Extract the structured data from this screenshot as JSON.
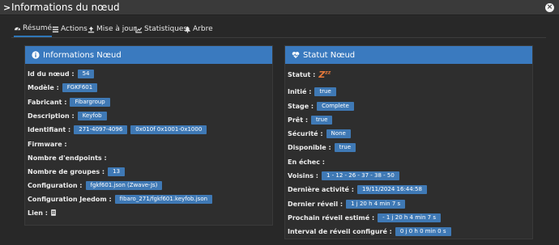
{
  "window": {
    "title": "Informations du nœud"
  },
  "tabs": [
    {
      "label": "Résumé",
      "icon": "dashboard-icon"
    },
    {
      "label": "Actions",
      "icon": "list-icon"
    },
    {
      "label": "Mise à jour",
      "icon": "upload-icon"
    },
    {
      "label": "Statistiques",
      "icon": "chart-icon"
    },
    {
      "label": "Arbre",
      "icon": "tree-icon"
    }
  ],
  "info_panel": {
    "title": "Informations Nœud",
    "rows": {
      "id": {
        "label": "Id du nœud :",
        "value": "54"
      },
      "model": {
        "label": "Modèle :",
        "value": "FGKF601"
      },
      "manufacturer": {
        "label": "Fabricant :",
        "value": "Fibargroup"
      },
      "description": {
        "label": "Description :",
        "value": "Keyfob"
      },
      "identifier": {
        "label": "Identifiant :",
        "value1": "271-4097-4096",
        "value2": "0x010f 0x1001-0x1000"
      },
      "firmware": {
        "label": "Firmware :"
      },
      "endpoints": {
        "label": "Nombre d'endpoints :"
      },
      "groups": {
        "label": "Nombre de groupes :",
        "value": "13"
      },
      "configuration": {
        "label": "Configuration :",
        "value": "fgkf601.json (Zwave-Js)"
      },
      "jeedom_config": {
        "label": "Configuration Jeedom :",
        "value": "fibaro_271/fgkf601.keyfob.json"
      },
      "link": {
        "label": "Lien :",
        "icon": "database-icon"
      }
    }
  },
  "status_panel": {
    "title": "Statut Nœud",
    "rows": {
      "status": {
        "label": "Statut :",
        "value": "Zzz",
        "icon": "sleeping-icon"
      },
      "initiated": {
        "label": "Initié :",
        "value": "true"
      },
      "stage": {
        "label": "Stage :",
        "value": "Complete"
      },
      "ready": {
        "label": "Prêt :",
        "value": "true"
      },
      "security": {
        "label": "Sécurité :",
        "value": "None"
      },
      "available": {
        "label": "Disponible :",
        "value": "true"
      },
      "failed": {
        "label": "En échec :"
      },
      "neighbors": {
        "label": "Voisins :",
        "value": "1 - 12 - 26 - 37 - 38 - 50"
      },
      "last_activity": {
        "label": "Dernière activité :",
        "value": "19/11/2024 16:44:58"
      },
      "last_wakeup": {
        "label": "Dernier réveil :",
        "value": "1 j 20 h 4 min 7 s"
      },
      "next_wakeup": {
        "label": "Prochain réveil estimé :",
        "value": "- 1 j 20 h 4 min 7 s"
      },
      "wakeup_interval": {
        "label": "Interval de réveil configuré :",
        "value": "0 j 0 h 0 min 0 s"
      }
    }
  },
  "colors": {
    "accent": "#3a7abf",
    "badge": "#3f79b5",
    "background": "#282828",
    "status_zzz": "#e8793a"
  }
}
